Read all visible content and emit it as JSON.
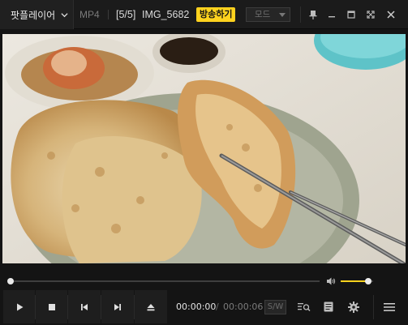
{
  "title_bar": {
    "app_name": "팟플레이어",
    "format": "MP4",
    "playlist_index": "[5/5]",
    "file_name": "IMG_5682",
    "broadcast_button": "방송하기",
    "mode_select": "모드"
  },
  "video": {
    "description_icon": "video-frame"
  },
  "seek": {
    "progress_fraction": 0.0,
    "volume_fraction": 0.85
  },
  "controls": {
    "current_time": "00:00:00",
    "separator": "/",
    "total_time": "00:00:06",
    "subtitle_sync_button": "S/W"
  },
  "colors": {
    "accent": "#ffd21e",
    "background": "#141414"
  }
}
